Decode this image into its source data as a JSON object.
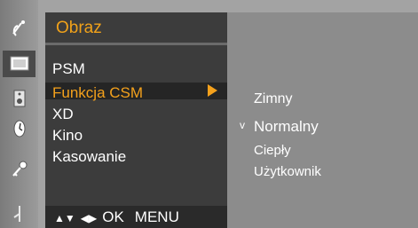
{
  "menu": {
    "title": "Obraz",
    "items": [
      {
        "label": "PSM"
      },
      {
        "label": "Funkcja CSM"
      },
      {
        "label": "XD"
      },
      {
        "label": "Kino"
      },
      {
        "label": "Kasowanie"
      }
    ],
    "selected_index": 1
  },
  "submenu": {
    "items": [
      {
        "label": "Zimny"
      },
      {
        "label": "Normalny"
      },
      {
        "label": "Ciepły"
      },
      {
        "label": "Użytkownik"
      }
    ],
    "checked_index": 1,
    "check_mark": "v"
  },
  "helpbar": {
    "updown": "▲▼",
    "leftright": "◀▶",
    "ok": "OK",
    "menu": "MENU"
  },
  "icons": [
    "satellite-dish-icon",
    "picture-screen-icon",
    "speaker-icon",
    "clock-icon",
    "key-icon",
    "extra-settings-icon"
  ],
  "colors": {
    "accent": "#f4a11c",
    "panel": "#3c3c3c",
    "subpanel": "#8c8c8c"
  }
}
